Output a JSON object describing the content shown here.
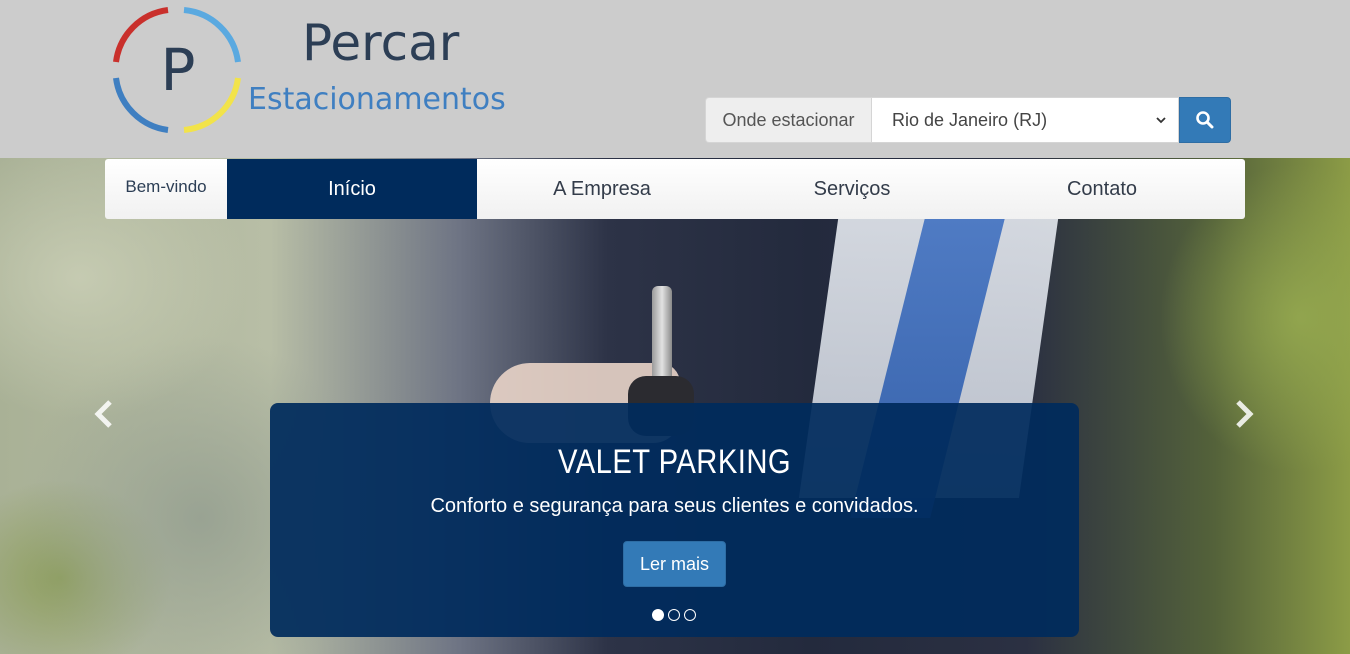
{
  "header": {
    "logo_letter": "P",
    "brand_name": "Percar",
    "brand_sub": "Estacionamentos",
    "colors": {
      "red": "#c9302c",
      "blue": "#3f7fc1",
      "yellow": "#f2e34a",
      "light_blue": "#5aa9e0"
    }
  },
  "search": {
    "label": "Onde estacionar",
    "selected_city": "Rio de Janeiro (RJ)",
    "button_icon": "search-icon"
  },
  "nav": {
    "welcome": "Bem-vindo",
    "items": [
      {
        "label": "Início",
        "active": true
      },
      {
        "label": "A Empresa",
        "active": false
      },
      {
        "label": "Serviços",
        "active": false
      },
      {
        "label": "Contato",
        "active": false
      }
    ]
  },
  "carousel": {
    "prev_icon": "chevron-left-icon",
    "next_icon": "chevron-right-icon",
    "slide": {
      "title": "VALET PARKING",
      "text": "Conforto e segurança para seus clientes e convidados.",
      "button_label": "Ler mais"
    },
    "indicators": {
      "count": 3,
      "active_index": 0
    }
  },
  "colors": {
    "nav_active": "#002b5c",
    "primary_button": "#337ab7",
    "caption_bg": "#002b5c"
  }
}
